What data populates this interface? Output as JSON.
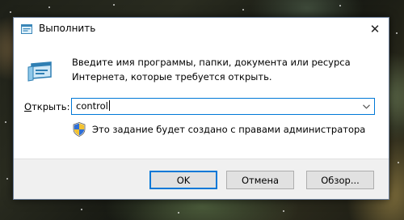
{
  "window": {
    "title": "Выполнить",
    "close_glyph": "✕"
  },
  "description_line1": "Введите имя программы, папки, документа или ресурса",
  "description_line2": "Интернета, которые требуется открыть.",
  "open_field": {
    "label_first": "О",
    "label_rest": "ткрыть:",
    "value": "control"
  },
  "admin_notice": "Это задание будет создано с правами администратора",
  "buttons": {
    "ok": "OK",
    "cancel": "Отмена",
    "browse": "Обзор..."
  },
  "icons": {
    "title_icon": "run-icon",
    "big_icon": "run-app-icon",
    "shield": "uac-shield-icon",
    "dropdown": "chevron-down-icon"
  },
  "colors": {
    "accent": "#0078d7",
    "footer_bg": "#f0f0f0",
    "button_bg": "#e1e1e1"
  }
}
